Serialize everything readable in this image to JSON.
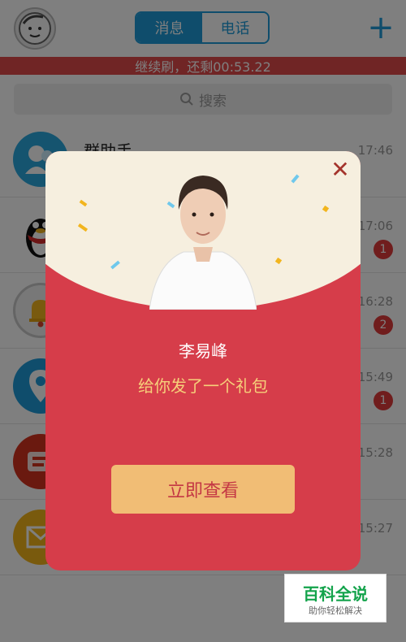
{
  "header": {
    "tabs": [
      {
        "label": "消息",
        "active": true
      },
      {
        "label": "电话",
        "active": false
      }
    ],
    "add_icon": "plus-icon"
  },
  "countdown": {
    "text": "继续刷，还剩00:53.22"
  },
  "search": {
    "placeholder": "搜索"
  },
  "conversations": [
    {
      "name": "群助手",
      "time": "17:46",
      "badge": ""
    },
    {
      "name": "",
      "time": "17:06",
      "badge": "1"
    },
    {
      "name": "",
      "time": "16:28",
      "badge": "2"
    },
    {
      "name": "",
      "time": "15:49",
      "badge": "1"
    },
    {
      "name": "",
      "time": "15:28",
      "badge": ""
    },
    {
      "name": "",
      "time": "15:27",
      "badge": ""
    }
  ],
  "gift_popup": {
    "sender": "李易峰",
    "message": "给你发了一个礼包",
    "button_label": "立即查看",
    "colors": {
      "panel": "#d63d4a",
      "header": "#f6efdf",
      "button": "#f1bd75",
      "message": "#f6d07a"
    }
  },
  "watermark": {
    "title": "百科全说",
    "subtitle": "助你轻松解决"
  }
}
